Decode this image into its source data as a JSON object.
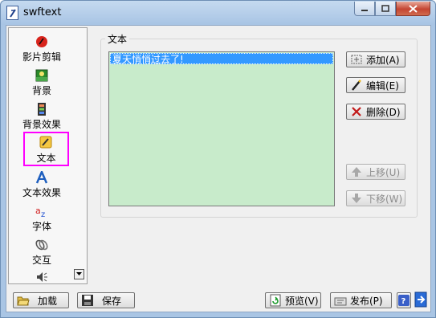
{
  "window": {
    "title": "swftext"
  },
  "sidebar": {
    "items": [
      {
        "label": "影片剪辑",
        "icon": "film-clip-icon"
      },
      {
        "label": "背景",
        "icon": "background-image-icon"
      },
      {
        "label": "背景效果",
        "icon": "film-strip-icon"
      },
      {
        "label": "文本",
        "icon": "pencil-icon"
      },
      {
        "label": "文本效果",
        "icon": "text-effect-icon"
      },
      {
        "label": "字体",
        "icon": "font-icon"
      },
      {
        "label": "交互",
        "icon": "interaction-icon"
      },
      {
        "label": "",
        "icon": "sound-icon"
      }
    ],
    "selected": "文本"
  },
  "main": {
    "group_title": "文本",
    "list": [
      "夏天悄悄过去了!"
    ],
    "buttons": {
      "add": "添加(A)",
      "edit": "编辑(E)",
      "delete": "删除(D)",
      "move_up": "上移(U)",
      "move_down": "下移(W)"
    }
  },
  "bottom": {
    "load": "加载",
    "save": "保存",
    "preview": "预览(V)",
    "publish": "发布(P)"
  },
  "colors": {
    "list_bg": "#c8ebcb",
    "selection": "#3399ff",
    "selected_outline": "#ff00ff"
  }
}
